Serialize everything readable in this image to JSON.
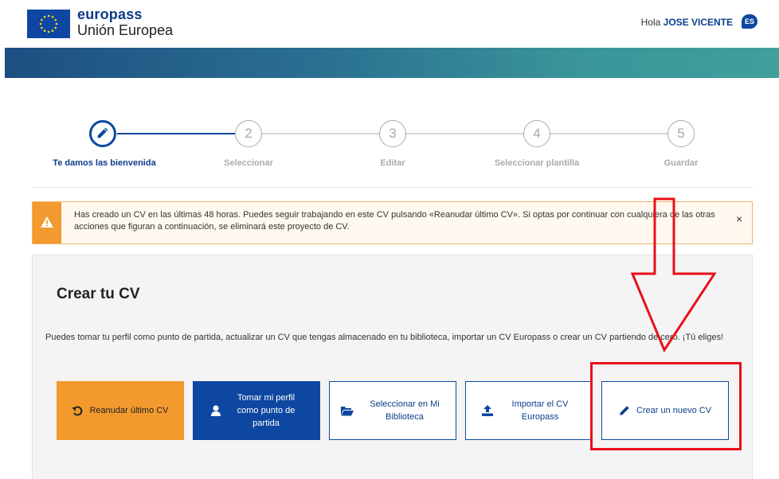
{
  "header": {
    "brand_top": "europass",
    "brand_bottom": "Unión Europea",
    "greeting": "Hola",
    "user_name": "JOSE VICENTE",
    "lang_code": "ES"
  },
  "colors": {
    "brand_blue": "#0e47a1",
    "orange": "#f29a2e",
    "annotation_red": "#e8101a"
  },
  "stepper": {
    "steps": [
      {
        "number": "",
        "label": "Te damos las bienvenida",
        "icon": "pencil-icon",
        "active": true
      },
      {
        "number": "2",
        "label": "Seleccionar",
        "active": false
      },
      {
        "number": "3",
        "label": "Editar",
        "active": false
      },
      {
        "number": "4",
        "label": "Seleccionar plantilla",
        "active": false
      },
      {
        "number": "5",
        "label": "Guardar",
        "active": false
      }
    ]
  },
  "alert": {
    "icon": "warning-icon",
    "text": "Has creado un CV en las últimas 48 horas. Puedes seguir trabajando en este CV pulsando «Reanudar último CV». Si optas por continuar con cualquiera de las otras acciones que figuran a continuación, se eliminará este proyecto de CV.",
    "close": "×"
  },
  "card": {
    "title": "Crear tu CV",
    "description": "Puedes tomar tu perfil como punto de partida, actualizar un CV que tengas almacenado en tu biblioteca, importar un CV Europass o crear un CV partiendo de cero. ¡Tú eliges!",
    "buttons": [
      {
        "label": "Reanudar último CV",
        "icon": "undo-icon"
      },
      {
        "label": "Tomar mi perfil como punto de partida",
        "icon": "user-icon"
      },
      {
        "label": "Seleccionar en Mi Biblioteca",
        "icon": "folder-open-icon"
      },
      {
        "label": "Importar el CV Europass",
        "icon": "upload-icon"
      },
      {
        "label": "Crear un nuevo CV",
        "icon": "pencil-icon"
      }
    ]
  }
}
